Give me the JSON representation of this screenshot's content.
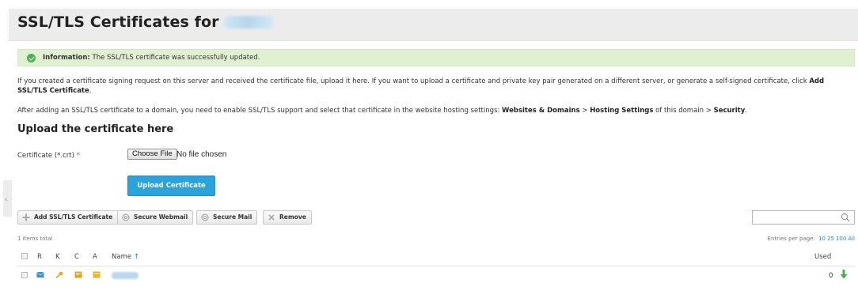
{
  "header": {
    "title": "SSL/TLS Certificates for"
  },
  "info": {
    "label": "Information:",
    "message": "The SSL/TLS certificate was successfully updated."
  },
  "paragraphs": {
    "p1_text": "If you created a certificate signing request on this server and received the certificate file, upload it here. If you want to upload a certificate and private key pair generated on a different server, or generate a self-signed certificate, click",
    "p1_link": "Add SSL/TLS Certificate",
    "p1_end": ".",
    "p2_text": "After adding an SSL/TLS certificate to a domain, you need to enable SSL/TLS support and select that certificate in the website hosting settings:",
    "p2_b1": "Websites & Domains",
    "p2_sep1": " > ",
    "p2_b2": "Hosting Settings",
    "p2_mid": " of this domain > ",
    "p2_b3": "Security",
    "p2_end": "."
  },
  "upload": {
    "heading": "Upload the certificate here",
    "cert_label": "Certificate (*.crt)",
    "required_mark": "*",
    "choose_file": "Choose File",
    "no_file": "No file chosen",
    "submit": "Upload Certificate"
  },
  "collapse": {
    "glyph": "‹"
  },
  "toolbar": {
    "add": "Add SSL/TLS Certificate",
    "webmail": "Secure Webmail",
    "mail": "Secure Mail",
    "remove": "Remove",
    "search_placeholder": ""
  },
  "list": {
    "total": "1 items total",
    "entries_label": "Entries per page:",
    "page_sizes": [
      "10",
      "25",
      "100",
      "All"
    ],
    "columns": {
      "r": "R",
      "k": "K",
      "c": "C",
      "a": "A",
      "name": "Name",
      "sort": "↑",
      "used": "Used"
    },
    "rows": [
      {
        "used": "0"
      }
    ]
  },
  "colors": {
    "accent": "#29a3d9",
    "success_bg": "#dff1d0",
    "link": "#1a8cc9"
  }
}
